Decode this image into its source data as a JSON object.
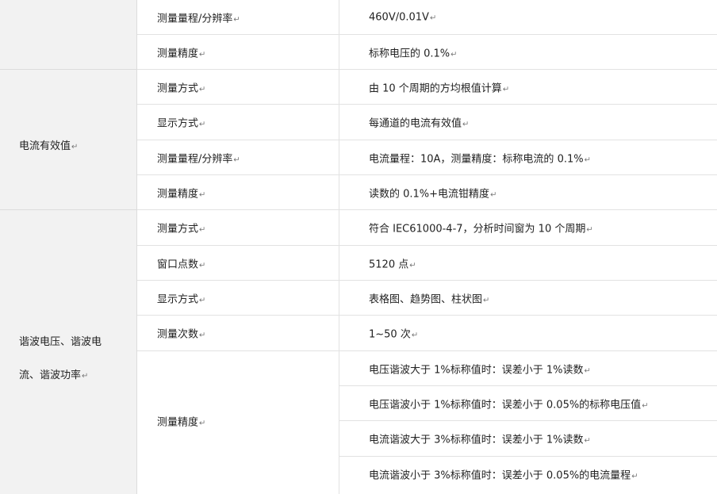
{
  "para_mark": "↵",
  "sections": [
    {
      "category_lines": [],
      "rows": [
        {
          "property": "测量量程/分辨率",
          "value": "460V/0.01V"
        },
        {
          "property": "测量精度",
          "value": "标称电压的 0.1%"
        }
      ]
    },
    {
      "category_lines": [
        "电流有效值"
      ],
      "rows": [
        {
          "property": "测量方式",
          "value": "由 10 个周期的方均根值计算"
        },
        {
          "property": "显示方式",
          "value": "每通道的电流有效值"
        },
        {
          "property": "测量量程/分辨率",
          "value": "电流量程：10A，测量精度：标称电流的 0.1%"
        },
        {
          "property": "测量精度",
          "value": "读数的 0.1%+电流钳精度"
        }
      ]
    },
    {
      "category_lines": [
        "谐波电压、谐波电",
        "流、谐波功率"
      ],
      "rows": [
        {
          "property": "测量方式",
          "value": "符合 IEC61000-4-7，分析时间窗为 10 个周期"
        },
        {
          "property": "窗口点数",
          "value": "5120 点"
        },
        {
          "property": "显示方式",
          "value": "表格图、趋势图、柱状图"
        },
        {
          "property": "测量次数",
          "value": "1~50 次"
        }
      ],
      "accuracy": {
        "property": "测量精度",
        "values": [
          "电压谐波大于 1%标称值时：误差小于 1%读数",
          "电压谐波小于 1%标称值时：误差小于 0.05%的标称电压值",
          "电流谐波大于 3%标称值时：误差小于 1%读数",
          "电流谐波小于 3%标称值时：误差小于 0.05%的电流量程"
        ]
      }
    }
  ]
}
